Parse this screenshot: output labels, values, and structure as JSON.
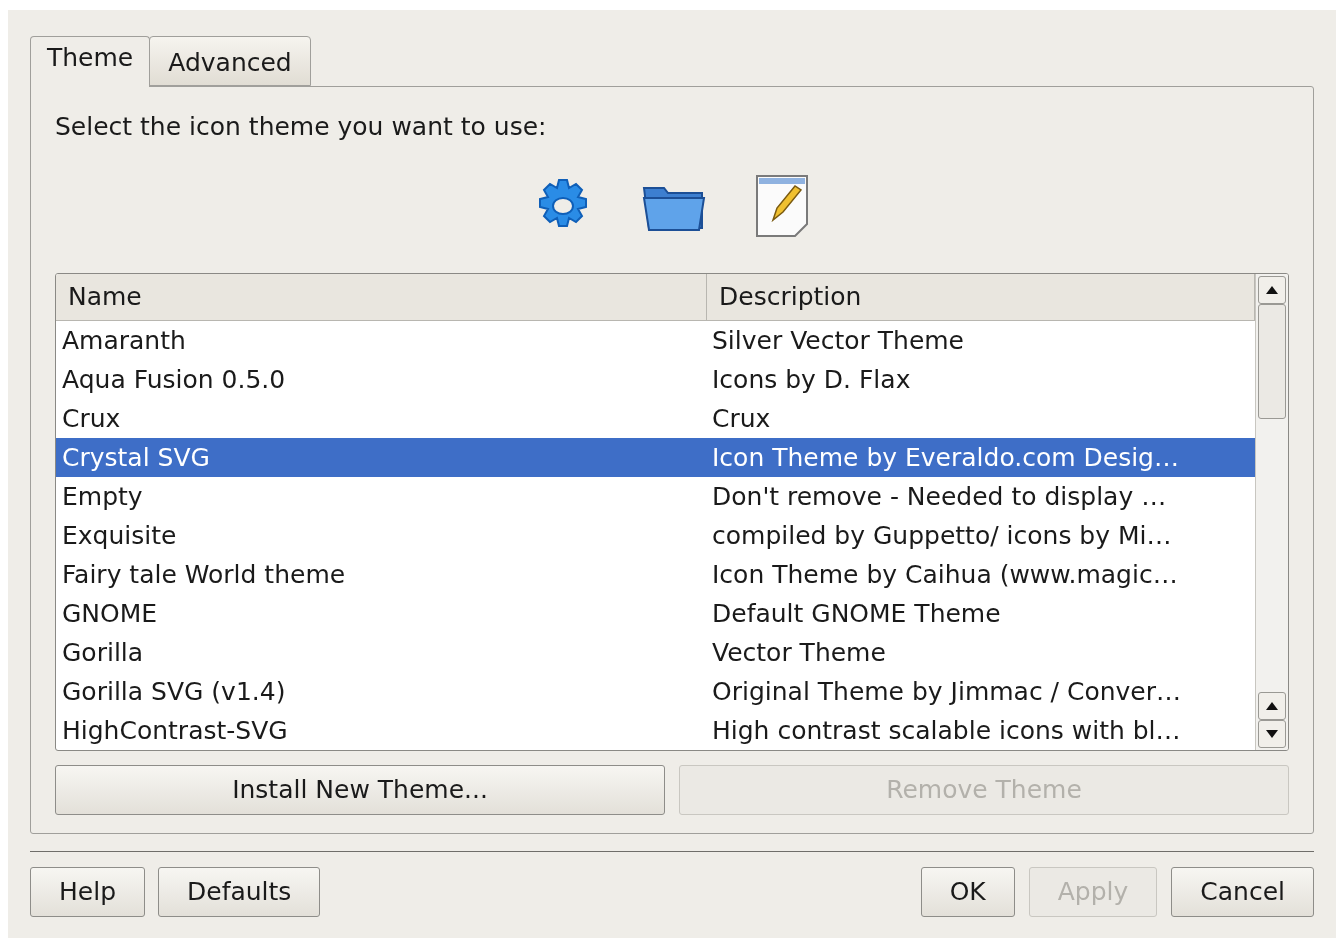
{
  "tabs": [
    {
      "label": "Theme",
      "selected": true
    },
    {
      "label": "Advanced",
      "selected": false
    }
  ],
  "prompt": "Select the icon theme you want to use:",
  "table": {
    "columns": [
      "Name",
      "Description"
    ],
    "rows": [
      {
        "name": "Amaranth",
        "description": "Silver Vector Theme",
        "selected": false
      },
      {
        "name": "Aqua Fusion 0.5.0",
        "description": "Icons by D. Flax",
        "selected": false
      },
      {
        "name": "Crux",
        "description": "Crux",
        "selected": false
      },
      {
        "name": "Crystal SVG",
        "description": "Icon Theme by Everaldo.com Desig…",
        "selected": true
      },
      {
        "name": "Empty",
        "description": "Don't remove - Needed to display …",
        "selected": false
      },
      {
        "name": "Exquisite",
        "description": "compiled by Guppetto/ icons by Mi…",
        "selected": false
      },
      {
        "name": "Fairy tale World theme",
        "description": "Icon Theme by Caihua (www.magic…",
        "selected": false
      },
      {
        "name": "GNOME",
        "description": "Default GNOME Theme",
        "selected": false
      },
      {
        "name": "Gorilla",
        "description": "Vector Theme",
        "selected": false
      },
      {
        "name": "Gorilla SVG (v1.4)",
        "description": "Original Theme by Jimmac / Conver…",
        "selected": false
      },
      {
        "name": "HighContrast-SVG",
        "description": "High contrast scalable icons with bl…",
        "selected": false
      }
    ]
  },
  "theme_buttons": [
    {
      "label": "Install New Theme...",
      "disabled": false
    },
    {
      "label": "Remove Theme",
      "disabled": true
    }
  ],
  "left_buttons": [
    {
      "label": "Help",
      "disabled": false
    },
    {
      "label": "Defaults",
      "disabled": false
    }
  ],
  "right_buttons": [
    {
      "label": "OK",
      "disabled": false
    },
    {
      "label": "Apply",
      "disabled": true
    },
    {
      "label": "Cancel",
      "disabled": false
    }
  ]
}
